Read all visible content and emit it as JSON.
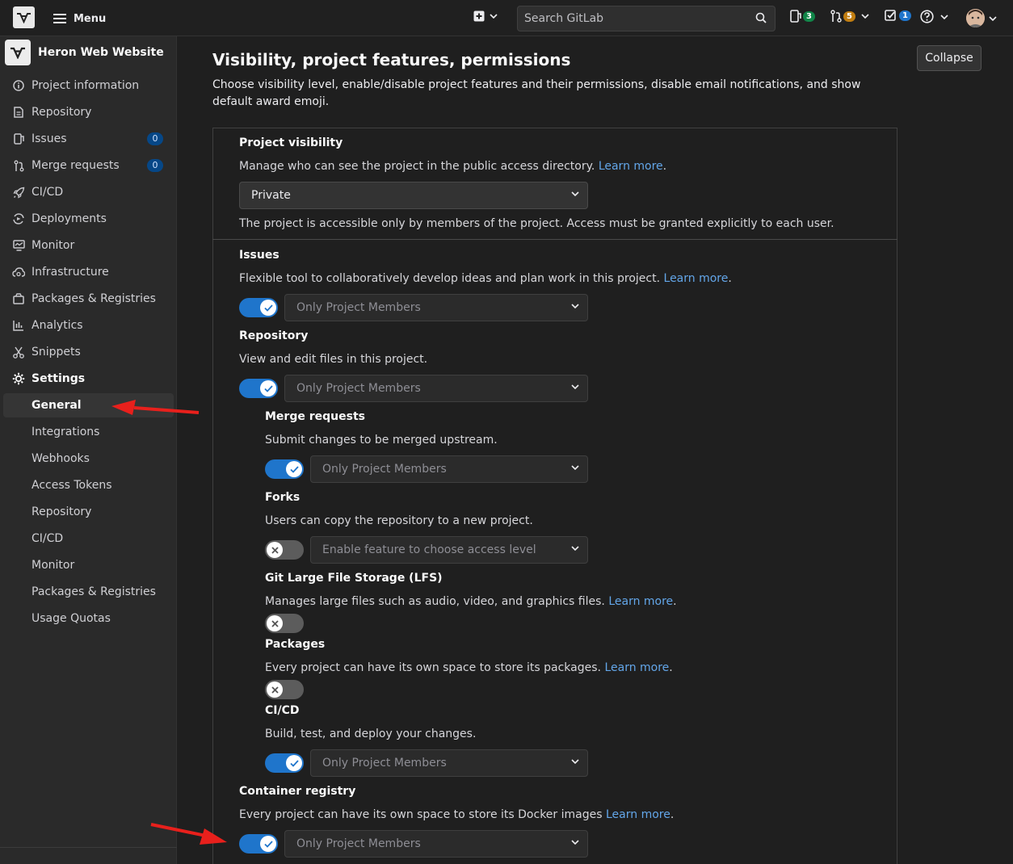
{
  "topbar": {
    "menu_label": "Menu",
    "search_placeholder": "Search GitLab",
    "issues_count": "3",
    "mr_count": "5",
    "todo_count": "1",
    "colors": {
      "issues": "#108548",
      "mr": "#c17d10",
      "todo": "#1f75cb"
    }
  },
  "sidebar": {
    "project_name": "Heron Web Website",
    "items": [
      {
        "label": "Project information",
        "icon": "info-icon"
      },
      {
        "label": "Repository",
        "icon": "doc-icon"
      },
      {
        "label": "Issues",
        "icon": "issues-icon",
        "badge": "0"
      },
      {
        "label": "Merge requests",
        "icon": "merge-request-icon",
        "badge": "0"
      },
      {
        "label": "CI/CD",
        "icon": "rocket-icon"
      },
      {
        "label": "Deployments",
        "icon": "deployments-icon"
      },
      {
        "label": "Monitor",
        "icon": "monitor-icon"
      },
      {
        "label": "Infrastructure",
        "icon": "cloud-gear-icon"
      },
      {
        "label": "Packages & Registries",
        "icon": "package-icon"
      },
      {
        "label": "Analytics",
        "icon": "chart-icon"
      },
      {
        "label": "Snippets",
        "icon": "scissors-icon"
      },
      {
        "label": "Settings",
        "icon": "gear-icon"
      }
    ],
    "settings_sub": [
      {
        "label": "General"
      },
      {
        "label": "Integrations"
      },
      {
        "label": "Webhooks"
      },
      {
        "label": "Access Tokens"
      },
      {
        "label": "Repository"
      },
      {
        "label": "CI/CD"
      },
      {
        "label": "Monitor"
      },
      {
        "label": "Packages & Registries"
      },
      {
        "label": "Usage Quotas"
      }
    ]
  },
  "main": {
    "title": "Visibility, project features, permissions",
    "collapse_label": "Collapse",
    "description": "Choose visibility level, enable/disable project features and their permissions, disable email notifications, and show default award emoji.",
    "learn_more": "Learn more",
    "visibility": {
      "title": "Project visibility",
      "desc": "Manage who can see the project in the public access directory.",
      "value": "Private",
      "note": "The project is accessible only by members of the project. Access must be granted explicitly to each user."
    },
    "features": [
      {
        "key": "issues",
        "title": "Issues",
        "desc": "Flexible tool to collaboratively develop ideas and plan work in this project.",
        "learn_more": true,
        "enabled": true,
        "select": "Only Project Members"
      },
      {
        "key": "repository",
        "title": "Repository",
        "desc": "View and edit files in this project.",
        "learn_more": false,
        "enabled": true,
        "select": "Only Project Members"
      },
      {
        "key": "merge_requests",
        "title": "Merge requests",
        "desc": "Submit changes to be merged upstream.",
        "learn_more": false,
        "enabled": true,
        "select": "Only Project Members"
      },
      {
        "key": "forks",
        "title": "Forks",
        "desc": "Users can copy the repository to a new project.",
        "learn_more": false,
        "enabled": false,
        "select": "Enable feature to choose access level"
      },
      {
        "key": "lfs",
        "title": "Git Large File Storage (LFS)",
        "desc": "Manages large files such as audio, video, and graphics files.",
        "learn_more": true,
        "enabled": false,
        "select": null
      },
      {
        "key": "packages",
        "title": "Packages",
        "desc": "Every project can have its own space to store its packages.",
        "learn_more": true,
        "enabled": false,
        "select": null
      },
      {
        "key": "cicd",
        "title": "CI/CD",
        "desc": "Build, test, and deploy your changes.",
        "learn_more": false,
        "enabled": true,
        "select": "Only Project Members"
      },
      {
        "key": "container_registry",
        "title": "Container registry",
        "desc": "Every project can have its own space to store its Docker images",
        "learn_more": true,
        "enabled": true,
        "select": "Only Project Members"
      }
    ]
  }
}
